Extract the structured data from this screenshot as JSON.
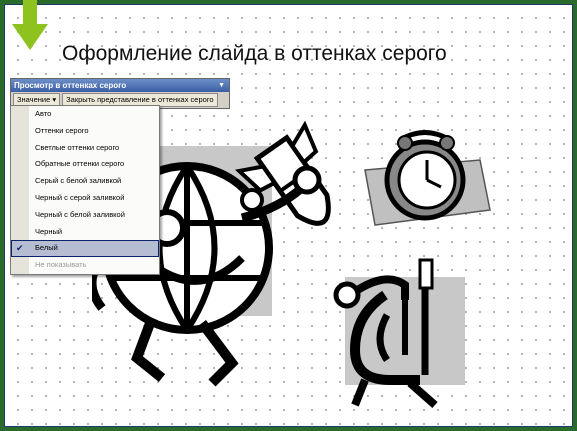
{
  "slide": {
    "title": "Оформление слайда в оттенках серого"
  },
  "toolbar": {
    "title": "Просмотр в оттенках серого",
    "value_button": "Значение",
    "close_button": "Закрыть представление в оттенках серого"
  },
  "menu": {
    "items": [
      {
        "label": "Авто",
        "state": "normal"
      },
      {
        "label": "Оттенки серого",
        "state": "normal"
      },
      {
        "label": "Светлые оттенки серого",
        "state": "normal"
      },
      {
        "label": "Обратные оттенки серого",
        "state": "normal"
      },
      {
        "label": "Серый с белой заливкой",
        "state": "normal"
      },
      {
        "label": "Черный с серой заливкой",
        "state": "normal"
      },
      {
        "label": "Черный с белой заливкой",
        "state": "normal"
      },
      {
        "label": "Черный",
        "state": "normal"
      },
      {
        "label": "Белый",
        "state": "checked"
      },
      {
        "label": "Не показывать",
        "state": "disabled"
      }
    ]
  },
  "colors": {
    "accent_arrow": "#8dc21f",
    "toolbar_title_bg": "#3a5fa6",
    "menu_selected_bg": "#b6bdd2"
  },
  "icons": [
    "green-down-arrow-icon",
    "chevron-down-icon",
    "checkmark-icon",
    "globe-rocket-clipart",
    "alarm-clock-clipart",
    "clamp-clipart"
  ]
}
